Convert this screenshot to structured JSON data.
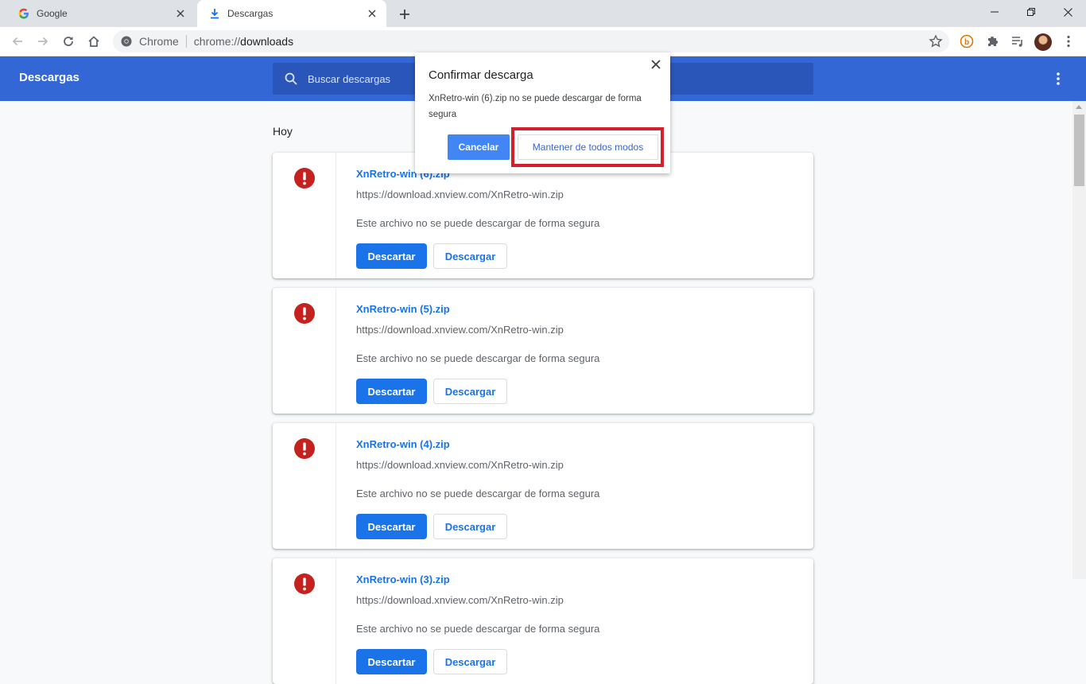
{
  "tabs": [
    {
      "label": "Google",
      "icon": "google-icon",
      "active": false
    },
    {
      "label": "Descargas",
      "icon": "download-icon",
      "active": true
    }
  ],
  "omnibox": {
    "site": "Chrome",
    "url_scheme": "chrome://",
    "url_host": "downloads"
  },
  "header": {
    "title": "Descargas",
    "search_placeholder": "Buscar descargas"
  },
  "day_label": "Hoy",
  "downloads": [
    {
      "name": "XnRetro-win (6).zip",
      "url": "https://download.xnview.com/XnRetro-win.zip",
      "status": "Este archivo no se puede descargar de forma segura",
      "discard": "Descartar",
      "keep": "Descargar"
    },
    {
      "name": "XnRetro-win (5).zip",
      "url": "https://download.xnview.com/XnRetro-win.zip",
      "status": "Este archivo no se puede descargar de forma segura",
      "discard": "Descartar",
      "keep": "Descargar"
    },
    {
      "name": "XnRetro-win (4).zip",
      "url": "https://download.xnview.com/XnRetro-win.zip",
      "status": "Este archivo no se puede descargar de forma segura",
      "discard": "Descartar",
      "keep": "Descargar"
    },
    {
      "name": "XnRetro-win (3).zip",
      "url": "https://download.xnview.com/XnRetro-win.zip",
      "status": "Este archivo no se puede descargar de forma segura",
      "discard": "Descartar",
      "keep": "Descargar"
    }
  ],
  "dialog": {
    "title": "Confirmar descarga",
    "message": "XnRetro-win (6).zip no se puede descargar de forma segura",
    "cancel": "Cancelar",
    "keep": "Mantener de todos modos"
  },
  "colors": {
    "header": "#3367d6",
    "accent": "#1a73e8",
    "warning": "#c5221f",
    "highlight": "#d4202b"
  }
}
